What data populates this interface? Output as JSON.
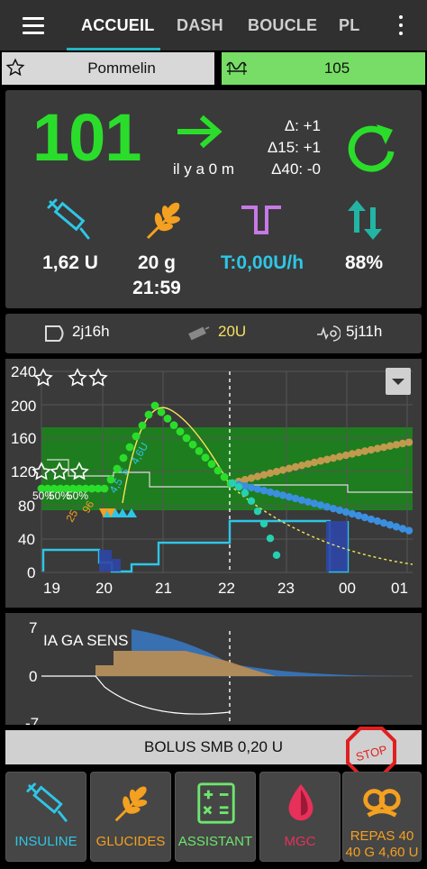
{
  "appbar": {
    "tabs": [
      "ACCUEIL",
      "DASH",
      "BOUCLE",
      "PL"
    ],
    "active_tab": "ACCUEIL"
  },
  "profile": {
    "name": "Pommelin"
  },
  "target_bar": {
    "value": "105"
  },
  "status": {
    "bg": "101",
    "ago": "il y a 0 m",
    "delta": "Δ: +1",
    "delta15": "Δ15: +1",
    "delta40": "Δ40:  -0",
    "iob": "1,62 U",
    "cob": "20 g",
    "cob_time": "21:59",
    "temp_basal": "T:0,00U/h",
    "sensitivity": "88%"
  },
  "info": {
    "cannula_age": "2j16h",
    "reservoir": "20U",
    "sensor_age": "5j11h"
  },
  "graph_main": {
    "y_ticks": [
      "240",
      "200",
      "160",
      "120",
      "80",
      "40",
      "0"
    ],
    "x_ticks": [
      "19",
      "20",
      "21",
      "22",
      "23",
      "00",
      "01"
    ],
    "markers": [
      "50%",
      "50%",
      "50%"
    ],
    "bolus_labels": [
      "25",
      "96",
      "4,5",
      "5",
      "4,6U"
    ]
  },
  "graph_small": {
    "label": "IA GA SENS",
    "y_ticks": [
      "7",
      "0",
      "-7"
    ]
  },
  "bolus_bar": {
    "label": "BOLUS SMB 0,20 U"
  },
  "stop_label": "STOP",
  "actions": [
    {
      "label": "INSULINE",
      "color": "#2ec6e6"
    },
    {
      "label": "GLUCIDES",
      "color": "#f4a020"
    },
    {
      "label": "ASSISTANT",
      "color": "#6ee56e"
    },
    {
      "label": "MGC",
      "color": "#e8305a"
    },
    {
      "label1": "REPAS 40",
      "label2": "40 G 4,60 U",
      "color": "#f4a020"
    }
  ],
  "colors": {
    "bg_green": "#2bdd2b",
    "insulin_cyan": "#2ec6e6",
    "carbs_orange": "#f4a020",
    "basal_violet": "#c779e6",
    "target_green": "#77dd66"
  }
}
